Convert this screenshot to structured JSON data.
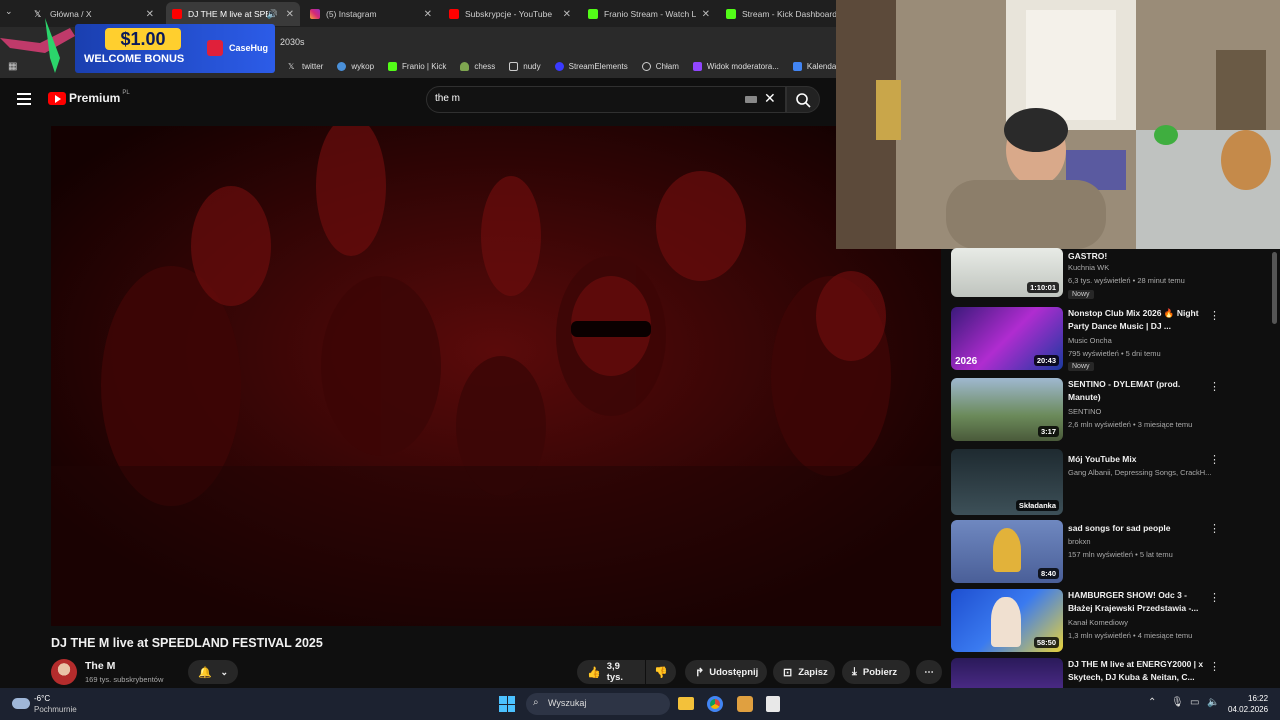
{
  "browser": {
    "tabs": [
      {
        "title": "Główna / X",
        "icon": "x-icon"
      },
      {
        "title": "DJ THE M live at SPEEDL",
        "icon": "youtube-icon",
        "active": true
      },
      {
        "title": "(5) Instagram",
        "icon": "instagram-icon"
      },
      {
        "title": "Subskrypcje - YouTube",
        "icon": "youtube-icon"
      },
      {
        "title": "Franio Stream - Watch Live",
        "icon": "kick-icon"
      },
      {
        "title": "Stream - Kick Dashboard",
        "icon": "kick-icon"
      }
    ],
    "address_fragment": "2030s",
    "bookmarks": [
      "twitter",
      "wykop",
      "Franio | Kick",
      "chess",
      "nudy",
      "StreamElements",
      "Chłam",
      "Widok moderatora...",
      "Kalendarz G"
    ]
  },
  "promo": {
    "amount": "$1.00",
    "subtitle": "WELCOME BONUS",
    "brand": "CaseHug"
  },
  "youtube": {
    "logo_text": "Premium",
    "logo_region": "PL",
    "search_value": "the m"
  },
  "video": {
    "title": "DJ THE M live at SPEEDLAND FESTIVAL 2025",
    "channel": "The M",
    "subscribers": "169 tys. subskrybentów",
    "likes": "3,9 tys.",
    "share_label": "Udostępnij",
    "save_label": "Zapisz",
    "download_label": "Pobierz"
  },
  "recommendations": [
    {
      "title": "GASTRO!",
      "channel": "Kuchnia WK",
      "meta": "6,3 tys. wyświetleń • 28 minut temu",
      "duration": "1:10:01",
      "badge": "Nowy",
      "color": "#d9dcd8"
    },
    {
      "title": "Nonstop Club Mix 2026 🔥 Night Party Dance Music | DJ ...",
      "channel": "Music Oncha",
      "meta": "795 wyświetleń • 5 dni temu",
      "duration": "20:43",
      "badge": "Nowy",
      "color": "#5a2a8a"
    },
    {
      "title": "SENTINO - DYLEMAT (prod. Manute)",
      "channel": "SENTINO",
      "meta": "2,6 mln wyświetleń • 3 miesiące temu",
      "duration": "3:17",
      "badge": "",
      "color": "#6b8a5a"
    },
    {
      "title": "Mój YouTube Mix",
      "channel": "Gang Albanii, Depressing Songs, CrackH...",
      "meta": "",
      "duration": "Składanka",
      "badge": "",
      "color": "#2d3d44"
    },
    {
      "title": "sad songs for sad people",
      "channel": "brokxn",
      "meta": "157 mln wyświetleń • 5 lat temu",
      "duration": "8:40",
      "badge": "",
      "color": "#5a6fa8"
    },
    {
      "title": "HAMBURGER SHOW!  Odc 3 - Błażej Krajewski Przedstawia -...",
      "channel": "Kanał Komediowy",
      "meta": "1,3 mln wyświetleń • 4 miesiące temu",
      "duration": "58:50",
      "badge": "",
      "color": "#2f5bc4"
    },
    {
      "title": "DJ THE M live at ENERGY2000 | x Skytech, DJ Kuba & Neitan, C...",
      "channel": "",
      "meta": "",
      "duration": "",
      "badge": "",
      "color": "#3a2a6a"
    }
  ],
  "taskbar": {
    "weather_temp": "-6°C",
    "weather_desc": "Pochmurnie",
    "search_placeholder": "Wyszukaj",
    "time": "16:22",
    "date": "04.02.2026"
  }
}
